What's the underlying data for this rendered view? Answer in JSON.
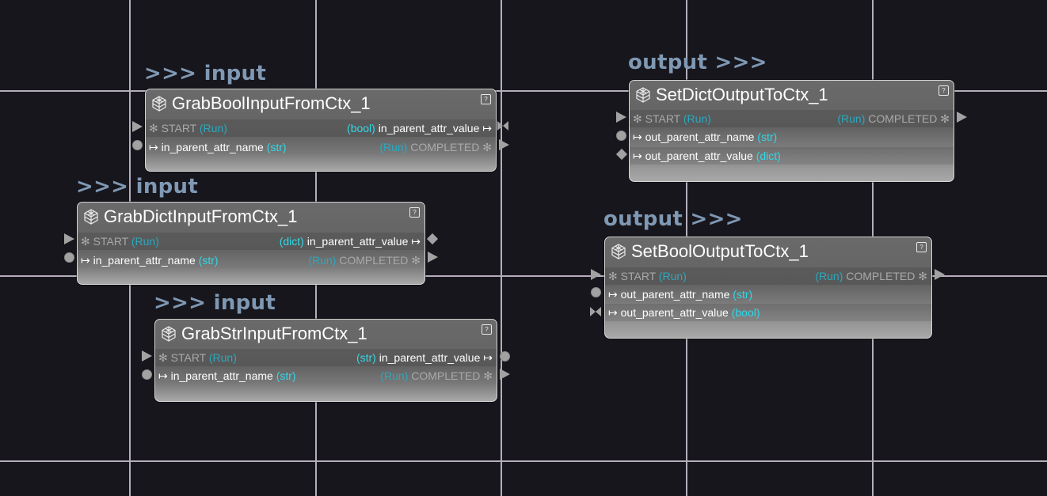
{
  "captions": {
    "input": ">>> input",
    "output": "output >>>"
  },
  "nodes": {
    "grab_bool": {
      "title": "GrabBoolInputFromCtx_1",
      "help": "?",
      "row1_left_mark": "✻",
      "row1_left": "START",
      "row1_left_type": "(Run)",
      "row1_right_type": "(bool)",
      "row1_right": "in_parent_attr_value",
      "row1_right_mark": "↦",
      "row2_left_mark": "↦",
      "row2_left": "in_parent_attr_name",
      "row2_left_type": "(str)",
      "row2_right_type": "(Run)",
      "row2_right": "COMPLETED",
      "row2_right_mark": "✻"
    },
    "grab_dict": {
      "title": "GrabDictInputFromCtx_1",
      "help": "?",
      "row1_left_mark": "✻",
      "row1_left": "START",
      "row1_left_type": "(Run)",
      "row1_right_type": "(dict)",
      "row1_right": "in_parent_attr_value",
      "row1_right_mark": "↦",
      "row2_left_mark": "↦",
      "row2_left": "in_parent_attr_name",
      "row2_left_type": "(str)",
      "row2_right_type": "(Run)",
      "row2_right": "COMPLETED",
      "row2_right_mark": "✻"
    },
    "grab_str": {
      "title": "GrabStrInputFromCtx_1",
      "help": "?",
      "row1_left_mark": "✻",
      "row1_left": "START",
      "row1_left_type": "(Run)",
      "row1_right_type": "(str)",
      "row1_right": "in_parent_attr_value",
      "row1_right_mark": "↦",
      "row2_left_mark": "↦",
      "row2_left": "in_parent_attr_name",
      "row2_left_type": "(str)",
      "row2_right_type": "(Run)",
      "row2_right": "COMPLETED",
      "row2_right_mark": "✻"
    },
    "set_dict": {
      "title": "SetDictOutputToCtx_1",
      "help": "?",
      "row1_left_mark": "✻",
      "row1_left": "START",
      "row1_left_type": "(Run)",
      "row1_right_type": "(Run)",
      "row1_right": "COMPLETED",
      "row1_right_mark": "✻",
      "row2_left_mark": "↦",
      "row2_left": "out_parent_attr_name",
      "row2_left_type": "(str)",
      "row3_left_mark": "↦",
      "row3_left": "out_parent_attr_value",
      "row3_left_type": "(dict)"
    },
    "set_bool": {
      "title": "SetBoolOutputToCtx_1",
      "help": "?",
      "row1_left_mark": "✻",
      "row1_left": "START",
      "row1_left_type": "(Run)",
      "row1_right_type": "(Run)",
      "row1_right": "COMPLETED",
      "row1_right_mark": "✻",
      "row2_left_mark": "↦",
      "row2_left": "out_parent_attr_name",
      "row2_left_type": "(str)",
      "row3_left_mark": "↦",
      "row3_left": "out_parent_attr_value",
      "row3_left_type": "(bool)"
    }
  },
  "colors": {
    "canvas": "#17161d",
    "grid": "#b4aebb",
    "caption": "#7f98b3",
    "type_accent": "#2fd9e8",
    "node_border": "#d6d6d6"
  },
  "icons": {
    "node": "cube-icon",
    "help": "help-icon"
  }
}
